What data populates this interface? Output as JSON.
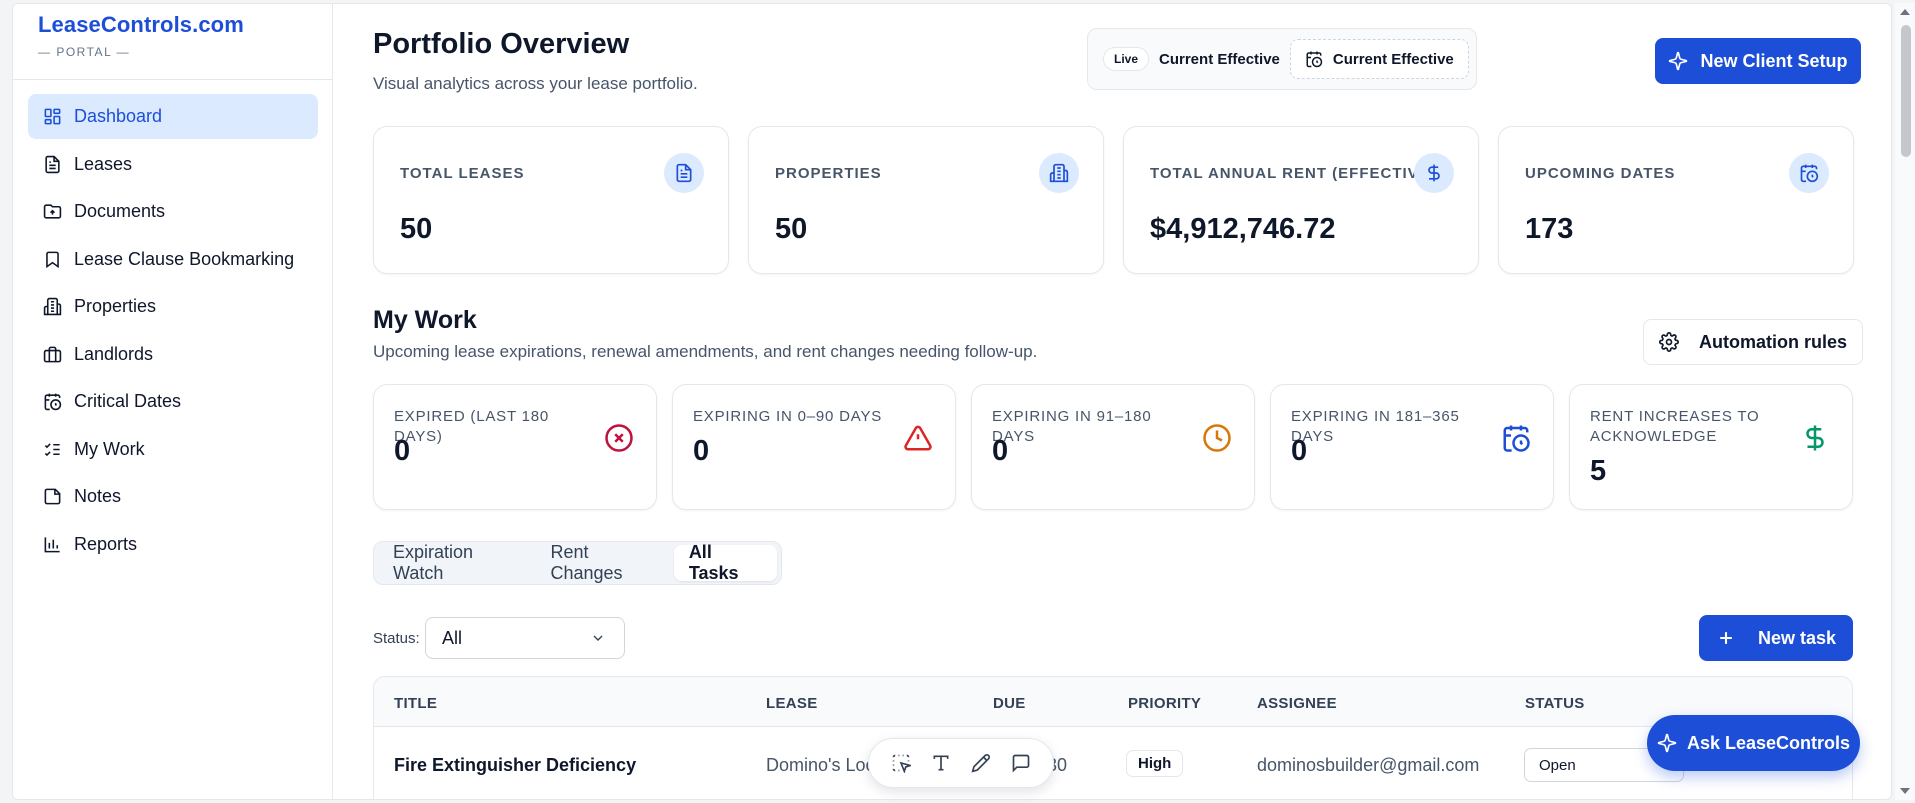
{
  "brand": {
    "name": "LeaseControls.com",
    "subtitle": "— PORTAL —"
  },
  "sidebar": {
    "items": [
      {
        "label": "Dashboard",
        "icon": "layout-dashboard-icon",
        "active": true
      },
      {
        "label": "Leases",
        "icon": "file-text-icon"
      },
      {
        "label": "Documents",
        "icon": "folder-up-icon"
      },
      {
        "label": "Lease Clause Bookmarking",
        "icon": "bookmark-icon"
      },
      {
        "label": "Properties",
        "icon": "building-icon"
      },
      {
        "label": "Landlords",
        "icon": "briefcase-icon"
      },
      {
        "label": "Critical Dates",
        "icon": "calendar-clock-icon"
      },
      {
        "label": "My Work",
        "icon": "list-checks-icon"
      },
      {
        "label": "Notes",
        "icon": "sticky-note-icon"
      },
      {
        "label": "Reports",
        "icon": "bar-chart-icon"
      }
    ]
  },
  "header": {
    "title": "Portfolio Overview",
    "subtitle": "Visual analytics across your lease portfolio.",
    "live_badge": "Live",
    "effective_label": "Current Effective",
    "effective_button": "Current Effective",
    "new_client_button": "New Client Setup"
  },
  "stats": [
    {
      "label": "TOTAL LEASES",
      "value": "50",
      "icon": "file-text-icon"
    },
    {
      "label": "PROPERTIES",
      "value": "50",
      "icon": "building-icon"
    },
    {
      "label": "TOTAL ANNUAL RENT (EFFECTIVE)",
      "value": "$4,912,746.72",
      "icon": "dollar-icon"
    },
    {
      "label": "UPCOMING DATES",
      "value": "173",
      "icon": "calendar-clock-icon"
    }
  ],
  "my_work": {
    "title": "My Work",
    "subtitle": "Upcoming lease expirations, renewal amendments, and rent changes needing follow-up.",
    "automation_button": "Automation rules",
    "cards": [
      {
        "label": "EXPIRED (LAST 180 DAYS)",
        "value": "0",
        "icon": "x-circle-icon",
        "color": "#be123c"
      },
      {
        "label": "EXPIRING IN 0–90 DAYS",
        "value": "0",
        "icon": "alert-triangle-icon",
        "color": "#dc2626"
      },
      {
        "label": "EXPIRING IN 91–180 DAYS",
        "value": "0",
        "icon": "clock-icon",
        "color": "#d97706"
      },
      {
        "label": "EXPIRING IN 181–365 DAYS",
        "value": "0",
        "icon": "calendar-clock-icon",
        "color": "#1d4ed8"
      },
      {
        "label": "RENT INCREASES TO ACKNOWLEDGE",
        "value": "5",
        "icon": "dollar-icon",
        "color": "#059669"
      }
    ],
    "tabs": [
      "Expiration Watch",
      "Rent Changes",
      "All Tasks"
    ],
    "active_tab": "All Tasks",
    "status_label": "Status:",
    "status_value": "All",
    "new_task_button": "New task"
  },
  "table": {
    "columns": [
      "TITLE",
      "LEASE",
      "DUE",
      "PRIORITY",
      "ASSIGNEE",
      "STATUS"
    ],
    "rows": [
      {
        "title": "Fire Extinguisher Deficiency",
        "lease": "Domino's Loc",
        "due": "-30",
        "priority": "High",
        "assignee": "dominosbuilder@gmail.com",
        "status": "Open"
      }
    ]
  },
  "ask_button": "Ask LeaseControls",
  "colors": {
    "accent": "#1d4ed8",
    "accent_light": "#dbeafe",
    "text": "#0f172a",
    "muted": "#475569"
  }
}
